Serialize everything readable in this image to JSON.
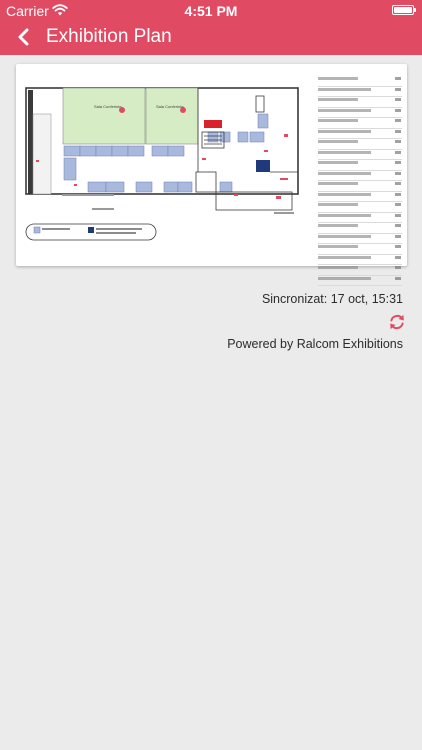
{
  "status_bar": {
    "carrier": "Carrier",
    "time": "4:51 PM",
    "wifi_icon": "wifi-icon",
    "battery_icon": "battery-full-icon"
  },
  "nav": {
    "title": "Exhibition Plan",
    "back_icon": "chevron-left-icon",
    "background_color": "#e04b63"
  },
  "map": {
    "room_labels": [
      "Sala Conferinte",
      "Sala Conferinte"
    ],
    "legend_rows": 20
  },
  "sync": {
    "text": "Sincronizat: 17 oct, 15:31",
    "refresh_icon": "refresh-icon",
    "refresh_color": "#e04b63"
  },
  "footer": {
    "powered_by": "Powered by Ralcom Exhibitions"
  },
  "colors": {
    "accent": "#e04b63",
    "background": "#ebebeb",
    "booth_fill": "#a9b9dd",
    "conference_fill": "#d5ecc4",
    "wall": "#3a3a3a",
    "navy_booth": "#1f3a7a"
  }
}
